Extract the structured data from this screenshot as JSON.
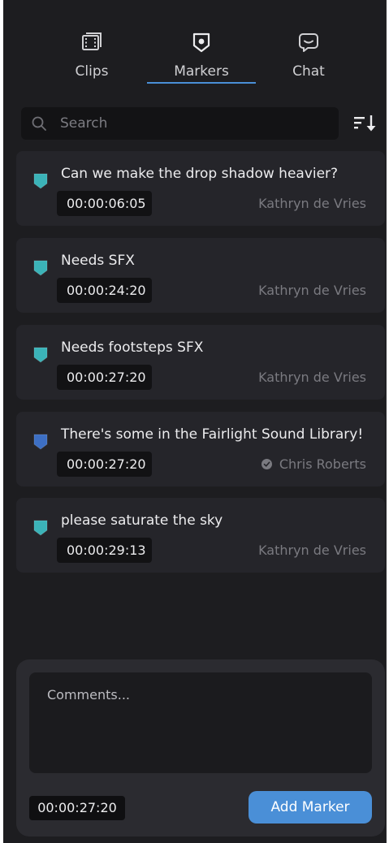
{
  "tabs": [
    {
      "label": "Clips",
      "icon": "film-icon"
    },
    {
      "label": "Markers",
      "icon": "marker-icon",
      "active": true
    },
    {
      "label": "Chat",
      "icon": "chat-icon"
    }
  ],
  "search": {
    "placeholder": "Search"
  },
  "sort": {
    "icon": "sort-descending-icon"
  },
  "markers": [
    {
      "text": "Can we make the drop shadow heavier?",
      "timecode": "00:00:06:05",
      "author": "Kathryn de Vries",
      "color": "#3bb3b8"
    },
    {
      "text": "Needs SFX",
      "timecode": "00:00:24:20",
      "author": "Kathryn de Vries",
      "color": "#3bb3b8"
    },
    {
      "text": "Needs footsteps SFX",
      "timecode": "00:00:27:20",
      "author": "Kathryn de Vries",
      "color": "#3bb3b8"
    },
    {
      "text": "There's some in the Fairlight Sound Library!",
      "timecode": "00:00:27:20",
      "author": "Chris Roberts",
      "color": "#3d6fc4",
      "verified": true
    },
    {
      "text": "please saturate the sky",
      "timecode": "00:00:29:13",
      "author": "Kathryn de Vries",
      "color": "#3bb3b8"
    }
  ],
  "composer": {
    "placeholder": "Comments...",
    "timecode": "00:00:27:20",
    "add_label": "Add Marker"
  },
  "colors": {
    "accent": "#4a8fd7",
    "panel_bg": "#1d1d20",
    "card_bg": "#25252a"
  }
}
